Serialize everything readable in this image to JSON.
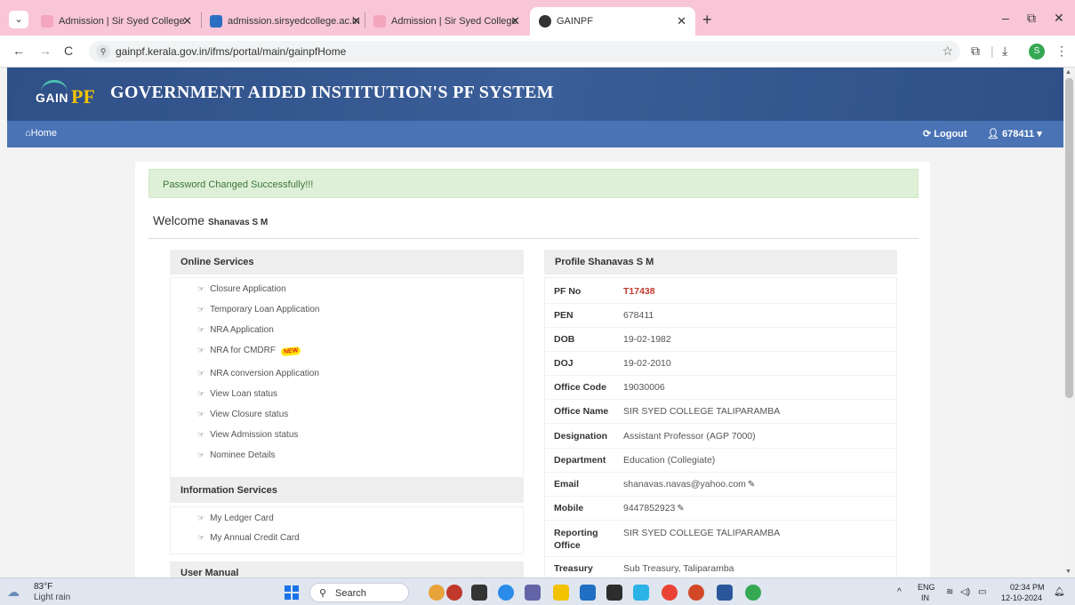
{
  "browser": {
    "tabs": [
      {
        "title": "Admission | Sir Syed College",
        "favicon_color": "#f4a6bf"
      },
      {
        "title": "admission.sirsyedcollege.ac.in",
        "favicon_color": "#2b6fc2"
      },
      {
        "title": "Admission | Sir Syed College",
        "favicon_color": "#f4a6bf"
      },
      {
        "title": "GAINPF",
        "favicon_color": "#333333"
      }
    ],
    "new_tab": "+",
    "tab_menu": "⌄",
    "url": "gainpf.kerala.gov.in/ifms/portal/main/gainpfHome",
    "profile_initial": "S",
    "window_controls": {
      "minimize": "–",
      "restore": "⧉",
      "close": "✕"
    }
  },
  "site": {
    "logo_text": "GAIN",
    "logo_pf": "PF",
    "title": "GOVERNMENT AIDED INSTITUTION'S PF SYSTEM",
    "nav": {
      "home": "Home",
      "logout": "Logout",
      "user": "678411"
    }
  },
  "main": {
    "alert": "Password Changed Successfully!!!",
    "welcome_prefix": "Welcome",
    "welcome_name": "Shanavas S M",
    "online_services": {
      "heading": "Online Services",
      "items": [
        {
          "label": "Closure Application"
        },
        {
          "label": "Temporary Loan Application"
        },
        {
          "label": "NRA Application"
        },
        {
          "label": "NRA for CMDRF",
          "badge": "NEW"
        },
        {
          "label": "NRA conversion Application"
        },
        {
          "label": "View Loan status"
        },
        {
          "label": "View Closure status"
        },
        {
          "label": "View Admission status"
        },
        {
          "label": "Nominee Details"
        }
      ]
    },
    "information_services": {
      "heading": "Information Services",
      "items": [
        {
          "label": "My Ledger Card"
        },
        {
          "label": "My Annual Credit Card"
        }
      ]
    },
    "user_manual": {
      "heading": "User Manual"
    },
    "profile": {
      "heading": "Profile Shanavas S M",
      "rows": [
        {
          "label": "PF No",
          "value": "T17438"
        },
        {
          "label": "PEN",
          "value": "678411"
        },
        {
          "label": "DOB",
          "value": "19-02-1982"
        },
        {
          "label": "DOJ",
          "value": "19-02-2010"
        },
        {
          "label": "Office Code",
          "value": "19030006"
        },
        {
          "label": "Office Name",
          "value": "SIR SYED COLLEGE TALIPARAMBA"
        },
        {
          "label": "Designation",
          "value": "Assistant Professor (AGP 7000)"
        },
        {
          "label": "Department",
          "value": "Education (Collegiate)"
        },
        {
          "label": "Email",
          "value": "shanavas.navas@yahoo.com"
        },
        {
          "label": "Mobile",
          "value": "9447852923"
        },
        {
          "label": "Reporting",
          "label2": "Office",
          "value": "SIR SYED COLLEGE TALIPARAMBA"
        },
        {
          "label": "Treasury",
          "value": "Sub Treasury, Taliparamba"
        }
      ]
    }
  },
  "taskbar": {
    "weather_temp": "83°F",
    "weather_desc": "Light rain",
    "search_label": "Search",
    "lang1": "ENG",
    "lang2": "IN",
    "time": "02:34 PM",
    "date": "12-10-2024"
  }
}
